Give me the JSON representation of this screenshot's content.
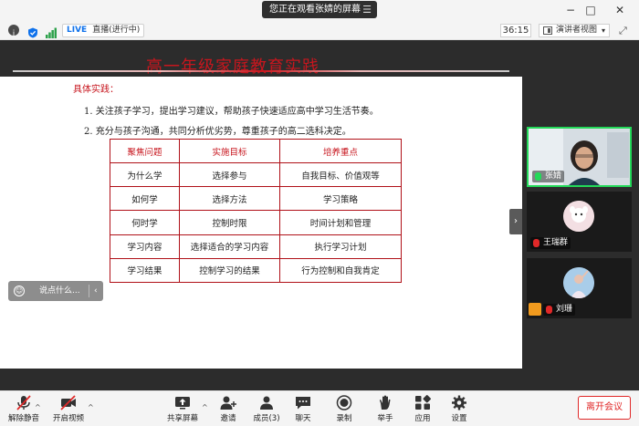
{
  "window": {
    "share_notice": "您正在观看张婧的屏幕",
    "minimize": "−",
    "maximize": "□",
    "close": "✕"
  },
  "status": {
    "live_tag": "LIVE",
    "live_text": "直播(进行中)",
    "timer": "36:15",
    "view_label": "演讲者视图"
  },
  "slide": {
    "title": "高一年级家庭教育实践",
    "section_label": "具体实践：",
    "points": [
      "1. 关注孩子学习，提出学习建议，帮助孩子快速适应高中学习生活节奏。",
      "2. 充分与孩子沟通，共同分析优劣势，尊重孩子的高二选科决定。"
    ],
    "table": {
      "headers": [
        "聚焦问题",
        "实施目标",
        "培养重点"
      ],
      "rows": [
        [
          "为什么学",
          "选择参与",
          "自我目标、价值观等"
        ],
        [
          "如何学",
          "选择方法",
          "学习策略"
        ],
        [
          "何时学",
          "控制时限",
          "时间计划和管理"
        ],
        [
          "学习内容",
          "选择适合的学习内容",
          "执行学习计划"
        ],
        [
          "学习结果",
          "控制学习的结果",
          "行为控制和自我肯定"
        ]
      ]
    }
  },
  "chat_float": {
    "placeholder": "说点什么..."
  },
  "participants": [
    {
      "name": "张婧"
    },
    {
      "name": "王瑞群"
    },
    {
      "name": "刘珊"
    }
  ],
  "toolbar": {
    "unmute": "解除静音",
    "start_video": "开启视频",
    "share_screen": "共享屏幕",
    "invite": "邀请",
    "members": "成员(3)",
    "chat": "聊天",
    "record": "录制",
    "raise_hand": "举手",
    "apps": "应用",
    "settings": "设置",
    "leave": "离开会议"
  },
  "colors": {
    "slide_red": "#c7161e",
    "active_speaker": "#23d959",
    "leave_red": "#e02828",
    "live_blue": "#0e71eb"
  }
}
